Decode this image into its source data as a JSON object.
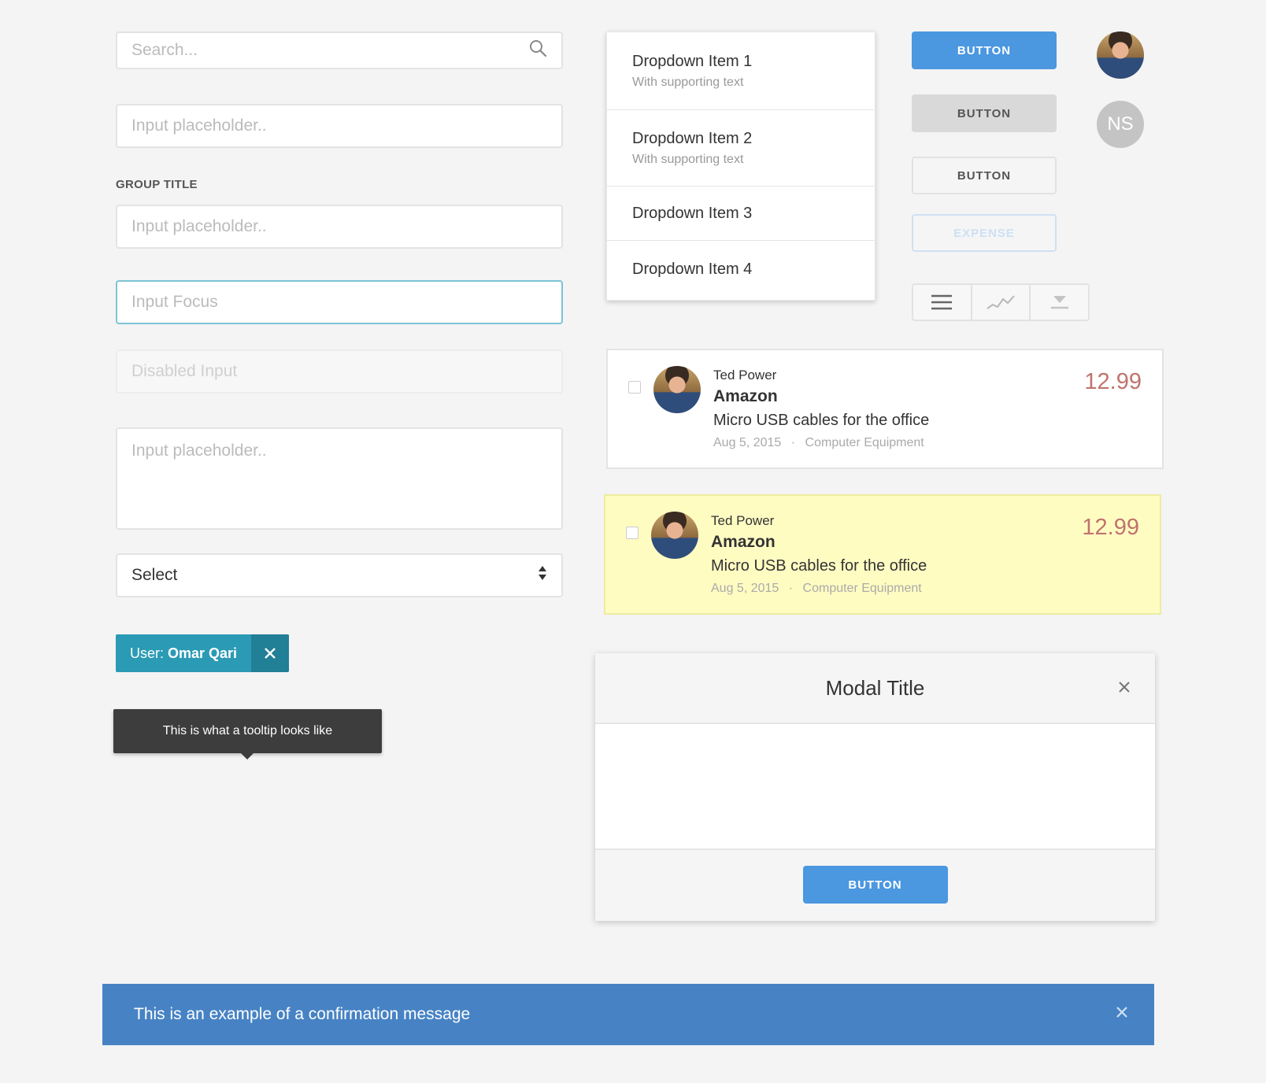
{
  "search": {
    "placeholder": "Search..."
  },
  "inputs": {
    "first_placeholder": "Input placeholder..",
    "group_title": "GROUP TITLE",
    "grouped_placeholder": "Input placeholder..",
    "focus_value": "Input Focus",
    "disabled_value": "Disabled Input",
    "textarea_placeholder": "Input placeholder.."
  },
  "select": {
    "value": "Select"
  },
  "tag": {
    "prefix": "User: ",
    "value": "Omar Qari"
  },
  "tooltip": {
    "text": "This is what a tooltip looks like"
  },
  "dropdown": {
    "items": [
      {
        "label": "Dropdown Item 1",
        "sub": "With supporting text"
      },
      {
        "label": "Dropdown Item 2",
        "sub": "With supporting text"
      },
      {
        "label": "Dropdown Item 3"
      },
      {
        "label": "Dropdown Item 4"
      }
    ]
  },
  "buttons": {
    "primary": "BUTTON",
    "secondary": "BUTTON",
    "outline": "BUTTON",
    "expense": "EXPENSE"
  },
  "avatars": {
    "initials": "NS"
  },
  "segmented": {
    "icons": [
      "menu-icon",
      "trend-line-icon",
      "download-icon"
    ]
  },
  "expenses": [
    {
      "name": "Ted Power",
      "merchant": "Amazon",
      "description": "Micro USB cables for the office",
      "date": "Aug 5, 2015",
      "separator": "·",
      "category": "Computer Equipment",
      "amount": "12.99",
      "highlighted": false
    },
    {
      "name": "Ted Power",
      "merchant": "Amazon",
      "description": "Micro USB cables for the office",
      "date": "Aug 5, 2015",
      "separator": "·",
      "category": "Computer Equipment",
      "amount": "12.99",
      "highlighted": true
    }
  ],
  "modal": {
    "title": "Modal Title",
    "button": "BUTTON"
  },
  "banner": {
    "message": "This is an example of a confirmation message"
  },
  "colors": {
    "primary": "#4b97e0",
    "tag": "#2b9ab5",
    "banner": "#4783c4",
    "amount": "#c0736d",
    "highlight": "#fffcc2"
  }
}
